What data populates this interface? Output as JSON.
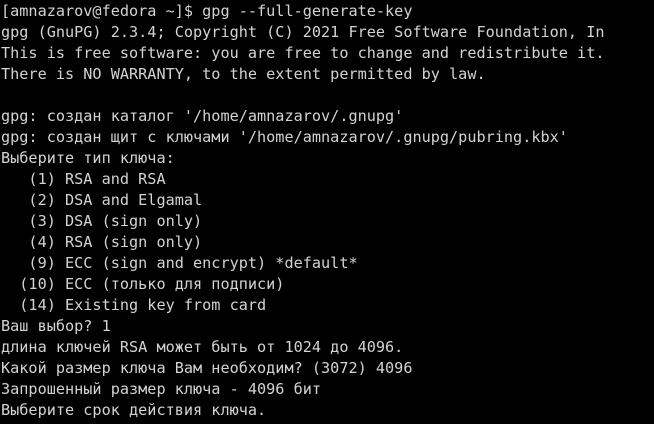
{
  "terminal": {
    "lines": [
      "[amnazarov@fedora ~]$ gpg --full-generate-key",
      "gpg (GnuPG) 2.3.4; Copyright (C) 2021 Free Software Foundation, In",
      "This is free software: you are free to change and redistribute it.",
      "There is NO WARRANTY, to the extent permitted by law.",
      "",
      "gpg: создан каталог '/home/amnazarov/.gnupg'",
      "gpg: создан щит с ключами '/home/amnazarov/.gnupg/pubring.kbx'",
      "Выберите тип ключа:",
      "   (1) RSA and RSA",
      "   (2) DSA and Elgamal",
      "   (3) DSA (sign only)",
      "   (4) RSA (sign only)",
      "   (9) ECC (sign and encrypt) *default*",
      "  (10) ECC (только для подписи)",
      "  (14) Existing key from card",
      "Ваш выбор? 1",
      "длина ключей RSA может быть от 1024 до 4096.",
      "Какой размер ключа Вам необходим? (3072) 4096",
      "Запрошенный размер ключа - 4096 бит",
      "Выберите срок действия ключа."
    ]
  }
}
